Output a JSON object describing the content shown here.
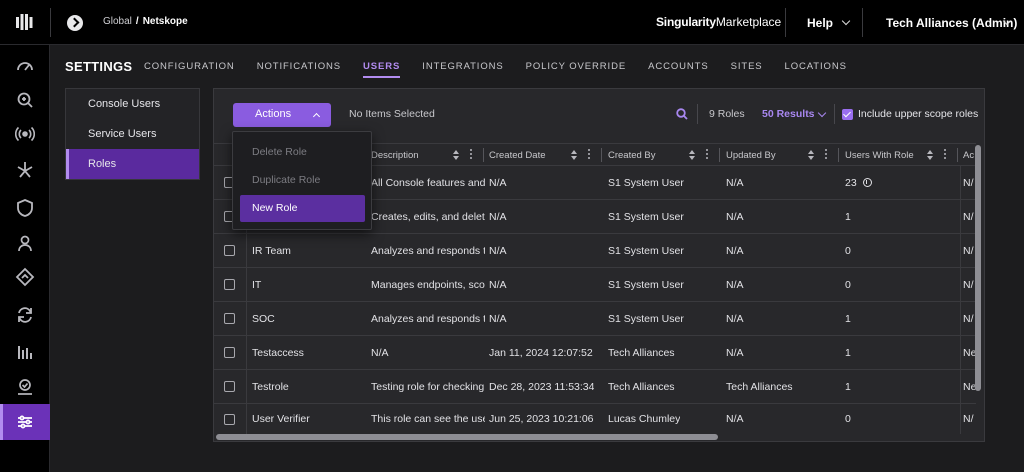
{
  "topbar": {
    "breadcrumb": [
      "Global",
      "Netskope"
    ],
    "breadcrumb_separator": "/",
    "marketplace_bold": "Singularity",
    "marketplace_rest": "Marketplace",
    "help": "Help",
    "account": "Tech Alliances (Admin)"
  },
  "sidebar": {
    "icons": [
      "dashboard-icon",
      "search-icon",
      "broadcast-icon",
      "asterisk-icon",
      "shield-icon",
      "user-icon",
      "diamond-arrow-icon",
      "sync-icon",
      "bar-chart-icon",
      "badge-icon",
      "sliders-icon"
    ],
    "active_index": 10
  },
  "settings": {
    "title": "SETTINGS",
    "tabs": [
      "CONFIGURATION",
      "NOTIFICATIONS",
      "USERS",
      "INTEGRATIONS",
      "POLICY OVERRIDE",
      "ACCOUNTS",
      "SITES",
      "LOCATIONS"
    ],
    "active_tab": "USERS"
  },
  "submenu": {
    "items": [
      "Console Users",
      "Service Users",
      "Roles"
    ],
    "active": "Roles"
  },
  "toolbar": {
    "actions_label": "Actions",
    "selection_text": "No Items Selected",
    "roles_count": "9 Roles",
    "results_label": "50 Results",
    "include_upper_label": "Include upper scope roles",
    "include_upper_checked": true
  },
  "actions_menu": {
    "items": [
      {
        "label": "Delete Role",
        "enabled": false
      },
      {
        "label": "Duplicate Role",
        "enabled": false
      },
      {
        "label": "New Role",
        "enabled": true
      }
    ]
  },
  "table": {
    "columns": [
      "Description",
      "Created Date",
      "Created By",
      "Updated By",
      "Users With Role",
      "Ac"
    ],
    "rows": [
      {
        "name": "",
        "description": "All Console features and...",
        "created_date": "N/A",
        "created_by": "S1 System User",
        "updated_by": "N/A",
        "users": "23",
        "ac": "N/",
        "info": true
      },
      {
        "name": "",
        "description": "Creates, edits, and delet...",
        "created_date": "N/A",
        "created_by": "S1 System User",
        "updated_by": "N/A",
        "users": "1",
        "ac": "N/"
      },
      {
        "name": "IR Team",
        "description": "Analyzes and responds t...",
        "created_date": "N/A",
        "created_by": "S1 System User",
        "updated_by": "N/A",
        "users": "0",
        "ac": "N/"
      },
      {
        "name": "IT",
        "description": "Manages endpoints, sco...",
        "created_date": "N/A",
        "created_by": "S1 System User",
        "updated_by": "N/A",
        "users": "0",
        "ac": "N/"
      },
      {
        "name": "SOC",
        "description": "Analyzes and responds t...",
        "created_date": "N/A",
        "created_by": "S1 System User",
        "updated_by": "N/A",
        "users": "1",
        "ac": "N/"
      },
      {
        "name": "Testaccess",
        "description": "N/A",
        "created_date": "Jan 11, 2024 12:07:52",
        "created_by": "Tech Alliances",
        "updated_by": "N/A",
        "users": "1",
        "ac": "Ne"
      },
      {
        "name": "Testrole",
        "description": "Testing role for checking...",
        "created_date": "Dec 28, 2023 11:53:34",
        "created_by": "Tech Alliances",
        "updated_by": "Tech Alliances",
        "users": "1",
        "ac": "Ne"
      },
      {
        "name": "User Verifier",
        "description": "This role can see the use...",
        "created_date": "Jun 25, 2023 10:21:06",
        "created_by": "Lucas Chumley",
        "updated_by": "N/A",
        "users": "0",
        "ac": "N/"
      }
    ]
  },
  "colors": {
    "accent": "#b28cf0",
    "active_bg": "#5a2a9e",
    "button": "#8a5ce0"
  }
}
